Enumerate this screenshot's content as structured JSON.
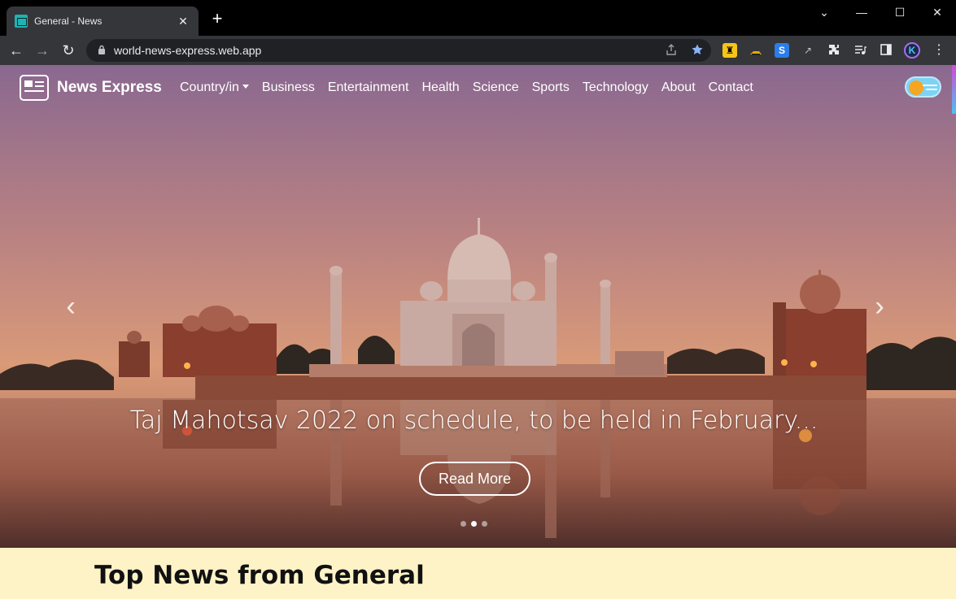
{
  "browser": {
    "tab_title": "General - News",
    "tab_close": "✕",
    "new_tab": "+",
    "url": "world-news-express.web.app",
    "window_controls": {
      "minimize": "—",
      "maximize": "☐",
      "close": "✕",
      "dropdown": "⌄"
    },
    "nav_icons": {
      "back": "←",
      "forward": "→",
      "reload": "↻"
    }
  },
  "site": {
    "brand": "News Express",
    "nav": [
      {
        "label": "Country/in",
        "dropdown": true
      },
      {
        "label": "Business"
      },
      {
        "label": "Entertainment"
      },
      {
        "label": "Health"
      },
      {
        "label": "Science"
      },
      {
        "label": "Sports"
      },
      {
        "label": "Technology"
      },
      {
        "label": "About"
      },
      {
        "label": "Contact"
      }
    ]
  },
  "hero": {
    "caption": "Taj Mahotsav 2022 on schedule, to be held in February...",
    "read_more": "Read More",
    "prev": "‹",
    "next": "›",
    "slides": 3,
    "active_slide": 2
  },
  "section": {
    "title": "Top News from General"
  },
  "colors": {
    "chrome_dark": "#000000",
    "toolbar": "#35363a",
    "section_bg": "#fef3c7",
    "tab_favicon": "#1fb3b3"
  }
}
